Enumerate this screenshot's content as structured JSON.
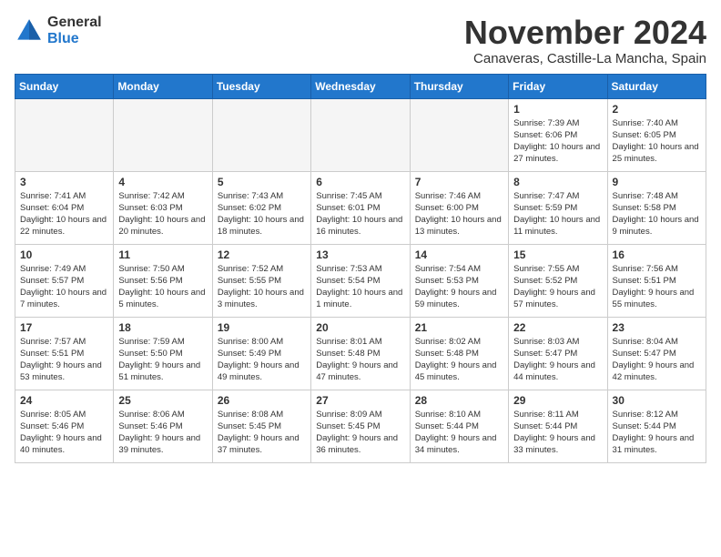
{
  "header": {
    "logo_general": "General",
    "logo_blue": "Blue",
    "month_title": "November 2024",
    "location": "Canaveras, Castille-La Mancha, Spain"
  },
  "weekdays": [
    "Sunday",
    "Monday",
    "Tuesday",
    "Wednesday",
    "Thursday",
    "Friday",
    "Saturday"
  ],
  "weeks": [
    [
      {
        "day": "",
        "info": ""
      },
      {
        "day": "",
        "info": ""
      },
      {
        "day": "",
        "info": ""
      },
      {
        "day": "",
        "info": ""
      },
      {
        "day": "",
        "info": ""
      },
      {
        "day": "1",
        "info": "Sunrise: 7:39 AM\nSunset: 6:06 PM\nDaylight: 10 hours and 27 minutes."
      },
      {
        "day": "2",
        "info": "Sunrise: 7:40 AM\nSunset: 6:05 PM\nDaylight: 10 hours and 25 minutes."
      }
    ],
    [
      {
        "day": "3",
        "info": "Sunrise: 7:41 AM\nSunset: 6:04 PM\nDaylight: 10 hours and 22 minutes."
      },
      {
        "day": "4",
        "info": "Sunrise: 7:42 AM\nSunset: 6:03 PM\nDaylight: 10 hours and 20 minutes."
      },
      {
        "day": "5",
        "info": "Sunrise: 7:43 AM\nSunset: 6:02 PM\nDaylight: 10 hours and 18 minutes."
      },
      {
        "day": "6",
        "info": "Sunrise: 7:45 AM\nSunset: 6:01 PM\nDaylight: 10 hours and 16 minutes."
      },
      {
        "day": "7",
        "info": "Sunrise: 7:46 AM\nSunset: 6:00 PM\nDaylight: 10 hours and 13 minutes."
      },
      {
        "day": "8",
        "info": "Sunrise: 7:47 AM\nSunset: 5:59 PM\nDaylight: 10 hours and 11 minutes."
      },
      {
        "day": "9",
        "info": "Sunrise: 7:48 AM\nSunset: 5:58 PM\nDaylight: 10 hours and 9 minutes."
      }
    ],
    [
      {
        "day": "10",
        "info": "Sunrise: 7:49 AM\nSunset: 5:57 PM\nDaylight: 10 hours and 7 minutes."
      },
      {
        "day": "11",
        "info": "Sunrise: 7:50 AM\nSunset: 5:56 PM\nDaylight: 10 hours and 5 minutes."
      },
      {
        "day": "12",
        "info": "Sunrise: 7:52 AM\nSunset: 5:55 PM\nDaylight: 10 hours and 3 minutes."
      },
      {
        "day": "13",
        "info": "Sunrise: 7:53 AM\nSunset: 5:54 PM\nDaylight: 10 hours and 1 minute."
      },
      {
        "day": "14",
        "info": "Sunrise: 7:54 AM\nSunset: 5:53 PM\nDaylight: 9 hours and 59 minutes."
      },
      {
        "day": "15",
        "info": "Sunrise: 7:55 AM\nSunset: 5:52 PM\nDaylight: 9 hours and 57 minutes."
      },
      {
        "day": "16",
        "info": "Sunrise: 7:56 AM\nSunset: 5:51 PM\nDaylight: 9 hours and 55 minutes."
      }
    ],
    [
      {
        "day": "17",
        "info": "Sunrise: 7:57 AM\nSunset: 5:51 PM\nDaylight: 9 hours and 53 minutes."
      },
      {
        "day": "18",
        "info": "Sunrise: 7:59 AM\nSunset: 5:50 PM\nDaylight: 9 hours and 51 minutes."
      },
      {
        "day": "19",
        "info": "Sunrise: 8:00 AM\nSunset: 5:49 PM\nDaylight: 9 hours and 49 minutes."
      },
      {
        "day": "20",
        "info": "Sunrise: 8:01 AM\nSunset: 5:48 PM\nDaylight: 9 hours and 47 minutes."
      },
      {
        "day": "21",
        "info": "Sunrise: 8:02 AM\nSunset: 5:48 PM\nDaylight: 9 hours and 45 minutes."
      },
      {
        "day": "22",
        "info": "Sunrise: 8:03 AM\nSunset: 5:47 PM\nDaylight: 9 hours and 44 minutes."
      },
      {
        "day": "23",
        "info": "Sunrise: 8:04 AM\nSunset: 5:47 PM\nDaylight: 9 hours and 42 minutes."
      }
    ],
    [
      {
        "day": "24",
        "info": "Sunrise: 8:05 AM\nSunset: 5:46 PM\nDaylight: 9 hours and 40 minutes."
      },
      {
        "day": "25",
        "info": "Sunrise: 8:06 AM\nSunset: 5:46 PM\nDaylight: 9 hours and 39 minutes."
      },
      {
        "day": "26",
        "info": "Sunrise: 8:08 AM\nSunset: 5:45 PM\nDaylight: 9 hours and 37 minutes."
      },
      {
        "day": "27",
        "info": "Sunrise: 8:09 AM\nSunset: 5:45 PM\nDaylight: 9 hours and 36 minutes."
      },
      {
        "day": "28",
        "info": "Sunrise: 8:10 AM\nSunset: 5:44 PM\nDaylight: 9 hours and 34 minutes."
      },
      {
        "day": "29",
        "info": "Sunrise: 8:11 AM\nSunset: 5:44 PM\nDaylight: 9 hours and 33 minutes."
      },
      {
        "day": "30",
        "info": "Sunrise: 8:12 AM\nSunset: 5:44 PM\nDaylight: 9 hours and 31 minutes."
      }
    ]
  ]
}
